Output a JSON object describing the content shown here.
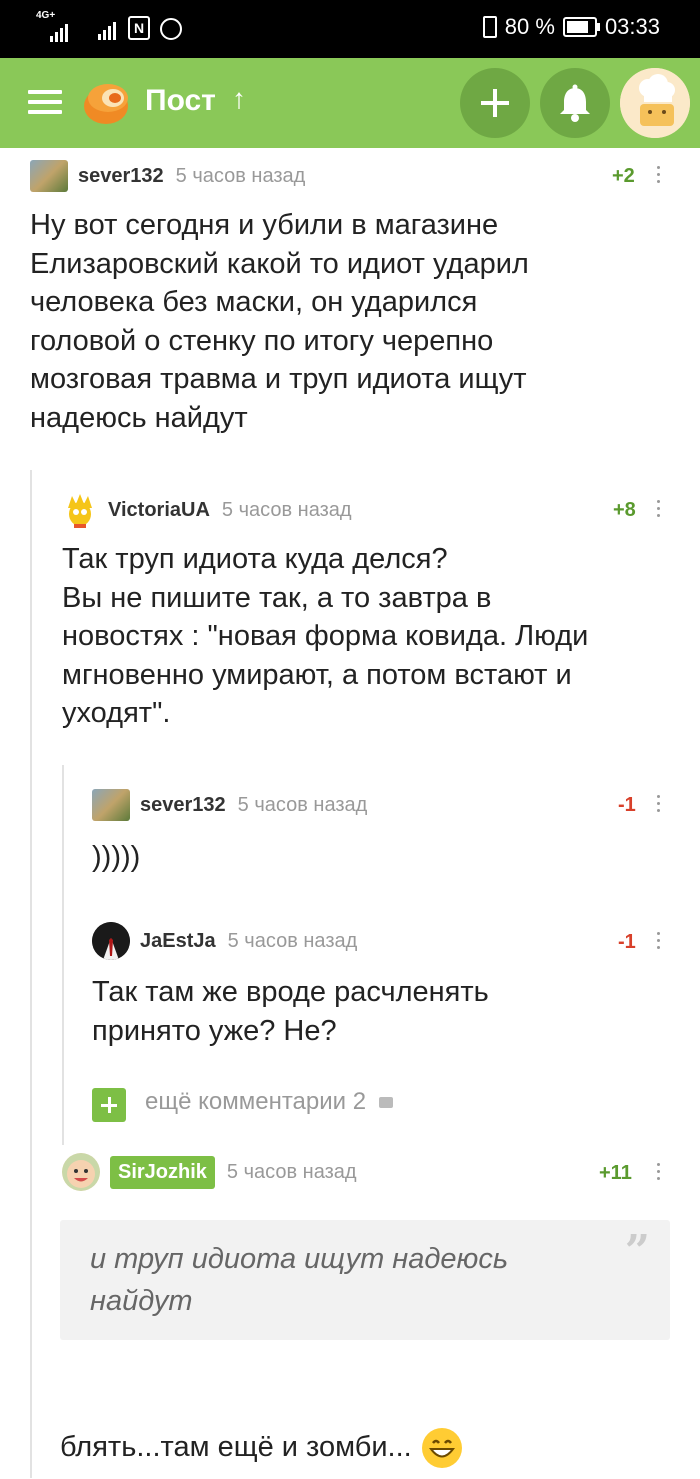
{
  "status_bar": {
    "network": "4G+",
    "battery": "80 %",
    "battery_level": 0.8,
    "time": "03:33"
  },
  "app_bar": {
    "title": "Пост",
    "title_icon": "arrow-up-icon",
    "colors": {
      "bar": "#8ac858",
      "button": "#6fa844"
    }
  },
  "comments": [
    {
      "user": "sever132",
      "time": "5 часов назад",
      "rating": "+2",
      "text": "Ну вот сегодня и убили в магазине\nЕлизаровский какой то идиот ударил\nчеловека без маски, он ударился\nголовой о стенку по итогу черепно\nмозговая травма и труп идиота ищут\nнадеюсь найдут"
    },
    {
      "user": "VictoriaUA",
      "time": "5 часов назад",
      "rating": "+8",
      "text": "Так труп идиота куда делся?\nВы не пишите так, а то завтра в\nновостях : \"новая форма ковида. Люди\nмгновенно умирают, а потом встают и\nуходят\"."
    },
    {
      "user": "sever132",
      "time": "5 часов назад",
      "rating": "-1",
      "text": ")))))"
    },
    {
      "user": "JaEstJa",
      "time": "5 часов назад",
      "rating": "-1",
      "text": "Так там же вроде расчленять\nпринято уже? Не?"
    },
    {
      "user": "SirJozhik",
      "time": "5 часов назад",
      "rating": "+11",
      "quote": "и труп идиота ищут надеюсь\nнайдут",
      "text": "блять...там ещё и зомби..."
    }
  ],
  "more_comments": {
    "label": "ещё комментарии 2"
  }
}
